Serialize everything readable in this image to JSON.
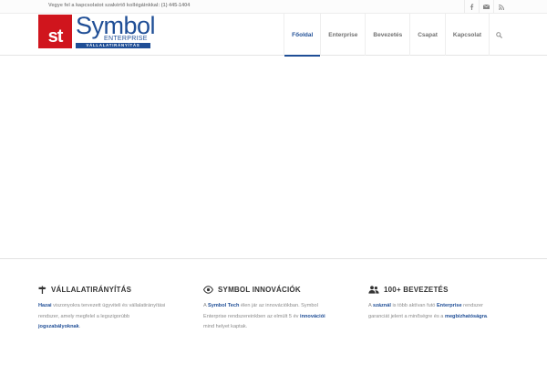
{
  "topbar": {
    "contact": "Vegye fel a kapcsolatot szakértő kollégáinkkal: (1) 445-1404",
    "social": [
      "facebook-icon",
      "mail-icon",
      "rss-icon"
    ]
  },
  "logo": {
    "mark": "st",
    "word": "Symbol",
    "sub": "ENTERPRISE",
    "band": "VÁLLALATIRÁNYÍTÁS"
  },
  "nav": {
    "items": [
      {
        "label": "Főoldal",
        "active": true
      },
      {
        "label": "Enterprise",
        "active": false
      },
      {
        "label": "Bevezetés",
        "active": false
      },
      {
        "label": "Csapat",
        "active": false
      },
      {
        "label": "Kapcsolat",
        "active": false
      }
    ],
    "search_icon": "search-icon"
  },
  "colors": {
    "brand_blue": "#1f4e96",
    "brand_red": "#d0151d",
    "text_gray": "#8a8a8a"
  },
  "features": [
    {
      "icon": "signpost-icon",
      "title": "VÁLLALATIRÁNYÍTÁS",
      "body": [
        {
          "t": "Hazai",
          "b": true
        },
        {
          "t": " viszonyokra tervezett ügyviteli és vállalatirányítási rendszer, amely megfelel a legszigorúbb ",
          "b": false
        },
        {
          "t": "jogszabályoknak",
          "b": true
        },
        {
          "t": ".",
          "b": false
        }
      ]
    },
    {
      "icon": "eye-icon",
      "title": "SYMBOL INNOVÁCIÓK",
      "body": [
        {
          "t": "A ",
          "b": false
        },
        {
          "t": "Symbol Tech",
          "b": true
        },
        {
          "t": " élen jár az innovációkban. Symbol Enterprise rendszereinkben az elmúlt 5 év ",
          "b": false
        },
        {
          "t": "innovációi",
          "b": true
        },
        {
          "t": " mind helyet kaptak.",
          "b": false
        }
      ]
    },
    {
      "icon": "users-icon",
      "title": "100+ BEVEZETÉS",
      "body": [
        {
          "t": "A ",
          "b": false
        },
        {
          "t": "száznál",
          "b": true
        },
        {
          "t": " is több aktívan futó ",
          "b": false
        },
        {
          "t": "Enterprise",
          "b": true
        },
        {
          "t": " rendszer garanciát jelent a minőségre és a ",
          "b": false
        },
        {
          "t": "megbízhatóságra",
          "b": true
        },
        {
          "t": ".",
          "b": false
        }
      ]
    }
  ]
}
